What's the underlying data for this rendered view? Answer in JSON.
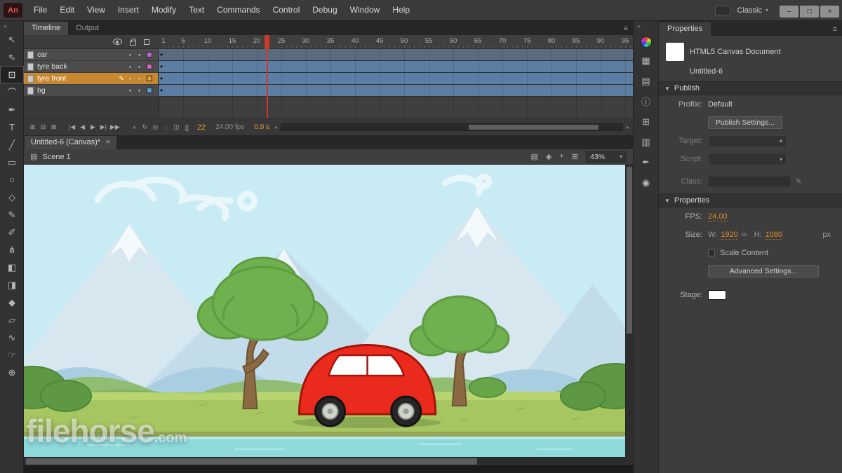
{
  "window": {
    "logo": "An",
    "workspace_label": "Classic",
    "workspace_caret": "▾",
    "minimize": "–",
    "restore": "□",
    "close": "×"
  },
  "menu": {
    "items": [
      "File",
      "Edit",
      "View",
      "Insert",
      "Modify",
      "Text",
      "Commands",
      "Control",
      "Debug",
      "Window",
      "Help"
    ]
  },
  "toolbar": {
    "collapse_icon": "«",
    "selected": "free-transform-tool",
    "tools": [
      {
        "name": "selection-tool",
        "glyph": "↖"
      },
      {
        "name": "subselection-tool",
        "glyph": "⇖"
      },
      {
        "name": "free-transform-tool",
        "glyph": "⊡"
      },
      {
        "name": "lasso-tool",
        "glyph": "⌒"
      },
      {
        "name": "pen-tool",
        "glyph": "✒"
      },
      {
        "name": "text-tool",
        "glyph": "T"
      },
      {
        "name": "line-tool",
        "glyph": "╱"
      },
      {
        "name": "rectangle-tool",
        "glyph": "▭"
      },
      {
        "name": "oval-tool",
        "glyph": "○"
      },
      {
        "name": "polystar-tool",
        "glyph": "◇"
      },
      {
        "name": "pencil-tool",
        "glyph": "✎"
      },
      {
        "name": "brush-tool",
        "glyph": "✐"
      },
      {
        "name": "bone-tool",
        "glyph": "⋔"
      },
      {
        "name": "paint-bucket-tool",
        "glyph": "◧"
      },
      {
        "name": "ink-bottle-tool",
        "glyph": "◨"
      },
      {
        "name": "eyedropper-tool",
        "glyph": "◆"
      },
      {
        "name": "eraser-tool",
        "glyph": "▱"
      },
      {
        "name": "width-tool",
        "glyph": "∿"
      },
      {
        "name": "hand-tool",
        "glyph": "☞"
      },
      {
        "name": "zoom-tool",
        "glyph": "⊕"
      }
    ]
  },
  "timeline": {
    "timeline_tab": "Timeline",
    "output_tab": "Output",
    "panel_menu_icon": "≡",
    "ruler_numbers": [
      1,
      5,
      10,
      15,
      20,
      25,
      30,
      35,
      40,
      45,
      50,
      55,
      60,
      65,
      70,
      75,
      80,
      85,
      90,
      95
    ],
    "playhead_frame": 22,
    "layers": [
      {
        "name": "car",
        "color": "#b96ad4",
        "span_color": "#5a6b80",
        "selected": false,
        "editing": false
      },
      {
        "name": "tyre back",
        "color": "#d66ac8",
        "span_color": "#5d7ea4",
        "selected": false,
        "editing": false
      },
      {
        "name": "tyre front",
        "color": "#e0a23e",
        "span_color": "#5d7ea4",
        "selected": true,
        "editing": true
      },
      {
        "name": "bg",
        "color": "#58a0d8",
        "span_color": "#5d7ea4",
        "selected": false,
        "editing": false
      }
    ],
    "layer_buttons": [
      {
        "name": "new-layer-icon",
        "glyph": "⊞"
      },
      {
        "name": "new-folder-icon",
        "glyph": "⊟"
      },
      {
        "name": "delete-layer-icon",
        "glyph": "⊠"
      }
    ],
    "transport": [
      {
        "name": "go-to-first-frame-icon",
        "glyph": "|◀"
      },
      {
        "name": "step-back-icon",
        "glyph": "◀"
      },
      {
        "name": "play-icon",
        "glyph": "▶"
      },
      {
        "name": "step-forward-icon",
        "glyph": "▶|"
      },
      {
        "name": "go-to-last-frame-icon",
        "glyph": "▶▶"
      }
    ],
    "onion": [
      {
        "name": "center-frame-icon",
        "glyph": "+"
      },
      {
        "name": "loop-icon",
        "glyph": "↻"
      },
      {
        "name": "onion-skin-icon",
        "glyph": "◎"
      },
      {
        "name": "onion-skin-outlines-icon",
        "glyph": "◌"
      },
      {
        "name": "edit-multiple-frames-icon",
        "glyph": "◫"
      },
      {
        "name": "modify-markers-icon",
        "glyph": "[]"
      }
    ],
    "status": {
      "current_frame": "22",
      "frame_rate": "24.00 fps",
      "elapsed_time": "0.9 s"
    }
  },
  "document": {
    "tab_label": "Untitled-6 (Canvas)*",
    "tab_close": "×"
  },
  "scene_bar": {
    "scene_icon": "▤",
    "scene_name": "Scene 1",
    "icons": [
      {
        "name": "edit-scene-icon",
        "glyph": "▤"
      },
      {
        "name": "edit-symbols-icon",
        "glyph": "◈"
      },
      {
        "name": "center-stage-icon",
        "glyph": "+"
      },
      {
        "name": "grid-icon",
        "glyph": "⊞"
      }
    ],
    "zoom_value": "43%",
    "zoom_caret": "▾"
  },
  "panel_strip": {
    "collapse_icon": "«",
    "icons": [
      {
        "name": "adobe-color-icon",
        "glyph": ""
      },
      {
        "name": "swatches-icon",
        "glyph": "▦"
      },
      {
        "name": "cc-libraries-icon",
        "glyph": "▤"
      },
      {
        "name": "info-icon",
        "glyph": "ⓘ"
      },
      {
        "name": "align-icon",
        "glyph": "⊞"
      },
      {
        "name": "library-icon",
        "glyph": "▥"
      },
      {
        "name": "brush-library-icon",
        "glyph": "✒"
      },
      {
        "name": "motion-presets-icon",
        "glyph": "◉"
      }
    ]
  },
  "properties": {
    "tab": "Properties",
    "panel_menu_icon": "≡",
    "doc_type": "HTML5 Canvas Document",
    "doc_name": "Untitled-6",
    "publish_section": "Publish",
    "profile_label": "Profile:",
    "profile_value": "Default",
    "publish_settings_button": "Publish Settings...",
    "target_label": "Target:",
    "script_label": "Script:",
    "class_label": "Class:",
    "pencil_icon": "✎",
    "select_caret": "▾",
    "properties_section": "Properties",
    "fps_label": "FPS:",
    "fps_value": "24.00",
    "size_label": "Size:",
    "w_label": "W:",
    "w_value": "1920",
    "link_icon": "∞",
    "h_label": "H:",
    "h_value": "1080",
    "px_label": "px",
    "scale_content_label": "Scale Content",
    "advanced_button": "Advanced Settings...",
    "stage_label": "Stage:"
  },
  "watermark": {
    "main": "filehorse",
    "suffix": ".com"
  },
  "colors": {
    "accent_orange": "#d98b2e",
    "selected_layer": "#c8882f",
    "frame_span_blue": "#5d7ea4",
    "playhead_red": "#cc392b"
  }
}
